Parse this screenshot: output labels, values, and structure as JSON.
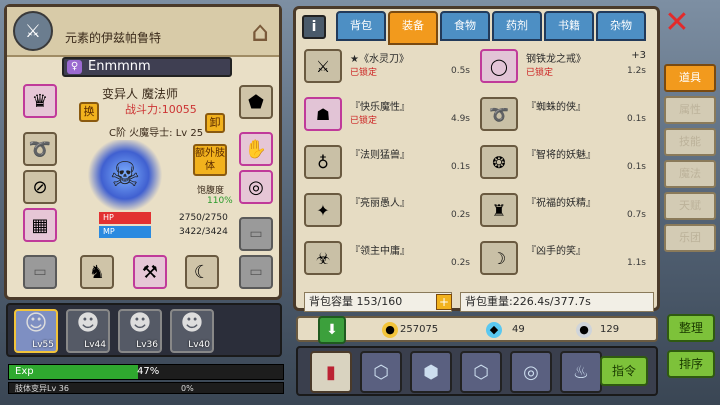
{
  "character": {
    "title": "元素的伊兹帕鲁特",
    "name": "Enmmnm",
    "race_class": "变异人 魔法师",
    "power": "战斗力:10055",
    "rank": "C阶 火魔导士: Lv 25",
    "swap_label": "换",
    "equip_label": "卸",
    "extra_label": "额外肢体",
    "satiety_label": "饱腹度",
    "satiety_value": "110%",
    "hp_label": "HP",
    "hp_value": "2750/2750",
    "mp_label": "MP",
    "mp_value": "3422/3424",
    "hp_fraction": 1.0,
    "mp_fraction": 0.999
  },
  "party": [
    {
      "level": "Lv55",
      "active": true
    },
    {
      "level": "Lv44",
      "active": false
    },
    {
      "level": "Lv36",
      "active": false
    },
    {
      "level": "Lv40",
      "active": false
    }
  ],
  "exp": {
    "label": "Exp",
    "percent": "47%",
    "fraction": 0.47,
    "sub_label": "肢体变异Lv 36",
    "sub_percent": "0%",
    "sub_fraction": 0.0
  },
  "inventory": {
    "tabs": [
      "背包",
      "装备",
      "食物",
      "药剂",
      "书籍",
      "杂物"
    ],
    "active_tab": 1,
    "items": [
      {
        "name": "★《水灵刀》",
        "lock": "已锁定",
        "time": "0.5s",
        "plus": ""
      },
      {
        "name": "钢铁龙之戒》",
        "lock": "已锁定",
        "time": "1.2s",
        "plus": "+3"
      },
      {
        "name": "『快乐魔性』",
        "lock": "已锁定",
        "time": "4.9s",
        "plus": ""
      },
      {
        "name": "『蜘蛛的侠』",
        "lock": "",
        "time": "0.1s",
        "plus": ""
      },
      {
        "name": "『法则猛兽』",
        "lock": "",
        "time": "0.1s",
        "plus": ""
      },
      {
        "name": "『智将的妖魅』",
        "lock": "",
        "time": "0.1s",
        "plus": ""
      },
      {
        "name": "『亮丽愚人』",
        "lock": "",
        "time": "0.2s",
        "plus": ""
      },
      {
        "name": "『祝福的妖精』",
        "lock": "",
        "time": "0.7s",
        "plus": ""
      },
      {
        "name": "『领主中庸』",
        "lock": "",
        "time": "0.2s",
        "plus": ""
      },
      {
        "name": "『凶手的笑』",
        "lock": "",
        "time": "1.1s",
        "plus": ""
      }
    ],
    "capacity": "背包容量 153/160",
    "weight": "背包重量:226.4s/377.7s"
  },
  "currency": {
    "gold": "257075",
    "gems": "49",
    "silver": "129"
  },
  "command_label": "指令",
  "side_tabs": [
    "道具",
    "属性",
    "技能",
    "魔法",
    "天赋",
    "乐团"
  ],
  "side_active": 0,
  "tidy_label": "整理",
  "sort_label": "排序"
}
